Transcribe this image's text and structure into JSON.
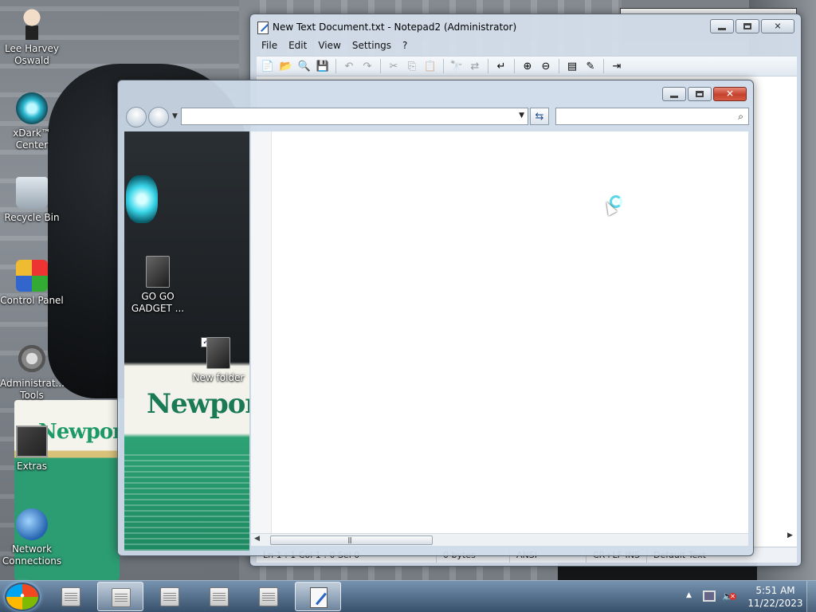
{
  "desktop": {
    "icons": [
      {
        "label": "Lee Harvey Oswald",
        "icon": "person-icon"
      },
      {
        "label": "xDark™ Center",
        "icon": "xdark-center-icon"
      },
      {
        "label": "Recycle Bin",
        "icon": "recycle-bin-icon"
      },
      {
        "label": "Control Panel",
        "icon": "control-panel-icon"
      },
      {
        "label": "Administrat... Tools",
        "icon": "administrative-tools-icon"
      },
      {
        "label": "Extras",
        "icon": "extras-icon"
      },
      {
        "label": "Network Connections",
        "icon": "network-connections-icon"
      }
    ],
    "wallpaper_text_left": "Newport"
  },
  "notepad": {
    "title": "New Text Document.txt - Notepad2 (Administrator)",
    "menu": [
      "File",
      "Edit",
      "View",
      "Settings",
      "?"
    ],
    "status": [
      "Ln 1 : 1   Col 1 : 0   Sel 0",
      "0 bytes",
      "ANSI",
      "CR+LF   INS",
      "Default Text"
    ]
  },
  "explorer": {
    "address_value": "",
    "search_value": "",
    "sidebar_items": [
      {
        "label": "GO GO GADGET ...",
        "icon": "gadget-folder-icon"
      },
      {
        "label": "New folder",
        "icon": "new-folder-icon"
      }
    ],
    "sidebar_brand": "Newport",
    "checkbox_glyph": "✓"
  },
  "taskbar": {
    "time": "5:51 AM",
    "date": "11/22/2023"
  }
}
